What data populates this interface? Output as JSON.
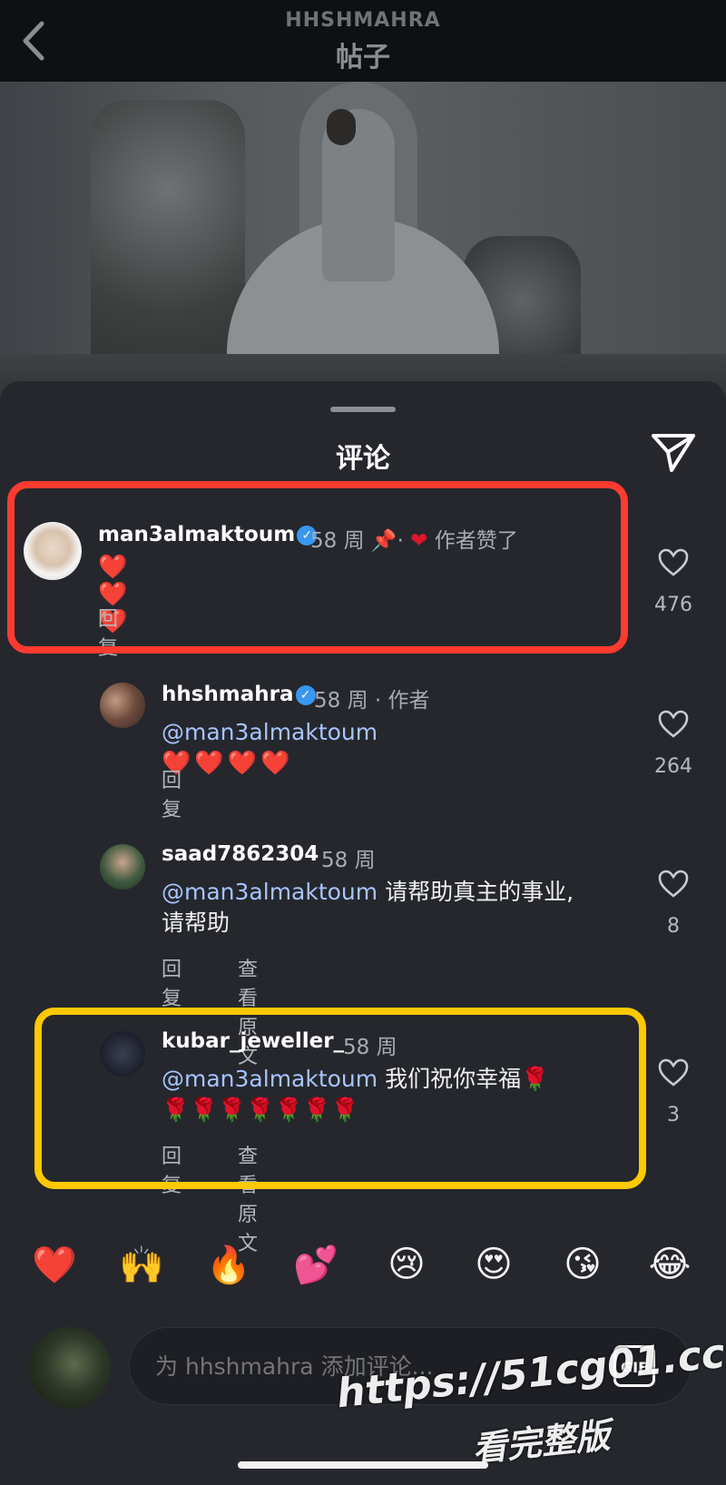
{
  "header": {
    "account": "HHSHMAHRA",
    "title": "帖子"
  },
  "sheet": {
    "title": "评论"
  },
  "comments": [
    {
      "username": "man3almaktoum",
      "verified": true,
      "age": "58 周",
      "pinned": true,
      "author_liked": "作者赞了",
      "text": "❤️❤️❤️",
      "reply": "回复",
      "likes": "476"
    },
    {
      "username": "hhshmahra",
      "verified": true,
      "age": "58 周",
      "role": "· 作者",
      "mention": "@man3almaktoum",
      "text": "❤️❤️❤️❤️",
      "reply": "回复",
      "likes": "264"
    },
    {
      "username": "saad7862304",
      "age": "58 周",
      "mention": "@man3almaktoum",
      "text_line1": "请帮助真主的事业,",
      "text_line2": "请帮助",
      "reply": "回复",
      "see_original": "查看原文",
      "likes": "8"
    },
    {
      "username": "kubar_jeweller_",
      "age": "58 周",
      "mention": "@man3almaktoum",
      "text_line1": "我们祝你幸福🌹",
      "text_line2": "🌹🌹🌹🌹🌹🌹🌹",
      "reply": "回复",
      "see_original": "查看原文",
      "likes": "3"
    }
  ],
  "quick_emojis": [
    "❤️",
    "🙌",
    "🔥",
    "💕",
    "😢",
    "😍",
    "😘",
    "😂"
  ],
  "composer": {
    "placeholder": "为 hhshmahra 添加评论...",
    "gif_label": "GIF"
  },
  "watermark": {
    "url": "https://51cg01.cc",
    "cta": "看完整版"
  },
  "colors": {
    "highlight_red": "#ff3b30",
    "highlight_yellow": "#ffc800",
    "verified": "#3897f0",
    "mention": "#a7c4ff",
    "heart": "#e0162b"
  }
}
